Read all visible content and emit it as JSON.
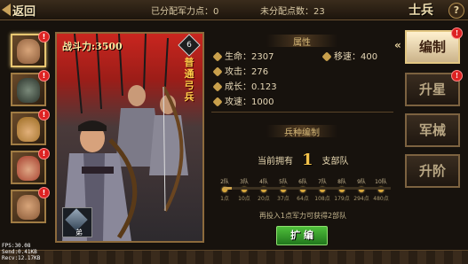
{
  "topbar": {
    "back_label": "返回",
    "allocated_label": "已分配军力点：",
    "allocated_value": "0",
    "unallocated_label": "未分配点数：",
    "unallocated_value": "23",
    "title": "士兵",
    "help": "?"
  },
  "heroes": [
    {
      "name": "hero-1",
      "badge": "!"
    },
    {
      "name": "hero-2",
      "badge": "!"
    },
    {
      "name": "hero-3",
      "badge": "!"
    },
    {
      "name": "hero-4",
      "badge": "!"
    },
    {
      "name": "hero-5",
      "badge": "!"
    }
  ],
  "portrait": {
    "power_label": "战斗力:3500",
    "rank": "6",
    "vertical_tag": "普通弓兵",
    "unit_type": "弟"
  },
  "attributes": {
    "section_title": "属性",
    "hp": "生命：2307",
    "move": "移速：400",
    "attack": "攻击：276",
    "growth": "成长：0.123",
    "atk_speed": "攻速：1000"
  },
  "troops": {
    "section_title": "兵种编制",
    "owned_prefix": "当前拥有",
    "owned_value": "1",
    "owned_suffix": "支部队",
    "progress": 0.05,
    "tiers": [
      {
        "top": "2队",
        "bot": "1点"
      },
      {
        "top": "3队",
        "bot": "10点"
      },
      {
        "top": "4队",
        "bot": "20点"
      },
      {
        "top": "5队",
        "bot": "37点"
      },
      {
        "top": "6队",
        "bot": "64点"
      },
      {
        "top": "7队",
        "bot": "108点"
      },
      {
        "top": "8队",
        "bot": "179点"
      },
      {
        "top": "9队",
        "bot": "294点"
      },
      {
        "top": "10队",
        "bot": "480点"
      }
    ],
    "hint": "再投入1点军力可获得2部队",
    "expand_label": "扩 编"
  },
  "tabs": [
    {
      "label": "编制",
      "active": true,
      "badge": "!"
    },
    {
      "label": "升星",
      "active": false,
      "badge": "!"
    },
    {
      "label": "军械",
      "active": false,
      "badge": ""
    },
    {
      "label": "升阶",
      "active": false,
      "badge": ""
    }
  ],
  "debug": {
    "fps": "FPS:30.08",
    "send": "Send:0.41KB",
    "recv": "Recv:12.17KB"
  },
  "colors": {
    "accent_gold": "#c9a04c",
    "expand_green": "#3aa02c",
    "badge_red": "#dd2222"
  }
}
